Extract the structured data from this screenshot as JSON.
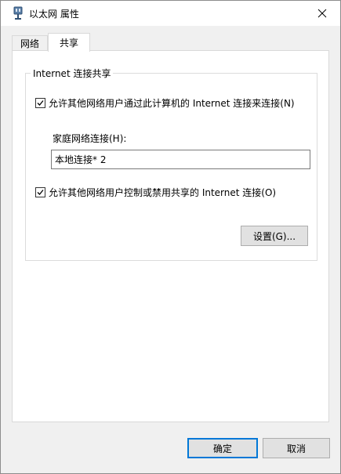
{
  "window": {
    "title": "以太网 属性"
  },
  "tabs": [
    {
      "label": "网络",
      "active": false
    },
    {
      "label": "共享",
      "active": true
    }
  ],
  "sharing": {
    "group_title": "Internet 连接共享",
    "allow_connect": {
      "label": "允许其他网络用户通过此计算机的 Internet 连接来连接(N)",
      "checked": true
    },
    "home_network_label": "家庭网络连接(H):",
    "home_network_value": "本地连接* 2",
    "allow_control": {
      "label": "允许其他网络用户控制或禁用共享的 Internet 连接(O)",
      "checked": true
    },
    "settings_button": "设置(G)..."
  },
  "footer": {
    "ok_label": "确定",
    "cancel_label": "取消"
  },
  "colors": {
    "accent": "#0078d7",
    "window_bg": "#f0f0f0",
    "panel_bg": "#ffffff"
  }
}
